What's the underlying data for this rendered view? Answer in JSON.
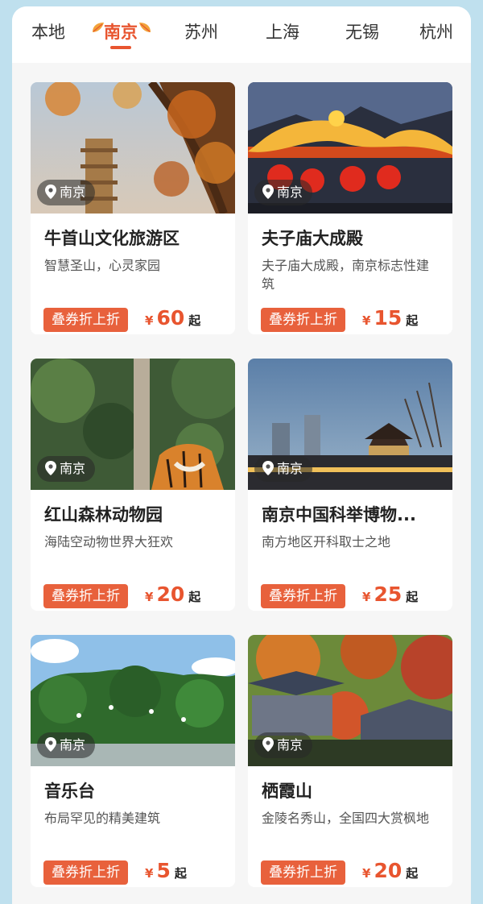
{
  "tabs": [
    {
      "label": "本地"
    },
    {
      "label": "南京",
      "active": true
    },
    {
      "label": "苏州"
    },
    {
      "label": "上海"
    },
    {
      "label": "无锡"
    },
    {
      "label": "杭州"
    }
  ],
  "colors": {
    "accent": "#e8552f",
    "badge": "#e8613c",
    "background": "#bfe0ee"
  },
  "cards": [
    {
      "location": "南京",
      "title": "牛首山文化旅游区",
      "desc": "智慧圣山，心灵家园",
      "badge": "叠券折上折",
      "currency": "¥",
      "price": "60",
      "suffix": "起"
    },
    {
      "location": "南京",
      "title": "夫子庙大成殿",
      "desc": "夫子庙大成殿，南京标志性建筑",
      "badge": "叠券折上折",
      "currency": "¥",
      "price": "15",
      "suffix": "起"
    },
    {
      "location": "南京",
      "title": "红山森林动物园",
      "desc": "海陆空动物世界大狂欢",
      "badge": "叠券折上折",
      "currency": "¥",
      "price": "20",
      "suffix": "起"
    },
    {
      "location": "南京",
      "title": "南京中国科举博物...",
      "desc": "南方地区开科取士之地",
      "badge": "叠券折上折",
      "currency": "¥",
      "price": "25",
      "suffix": "起"
    },
    {
      "location": "南京",
      "title": "音乐台",
      "desc": "布局罕见的精美建筑",
      "badge": "叠券折上折",
      "currency": "¥",
      "price": "5",
      "suffix": "起"
    },
    {
      "location": "南京",
      "title": "栖霞山",
      "desc": "金陵名秀山，全国四大赏枫地",
      "badge": "叠券折上折",
      "currency": "¥",
      "price": "20",
      "suffix": "起"
    }
  ]
}
